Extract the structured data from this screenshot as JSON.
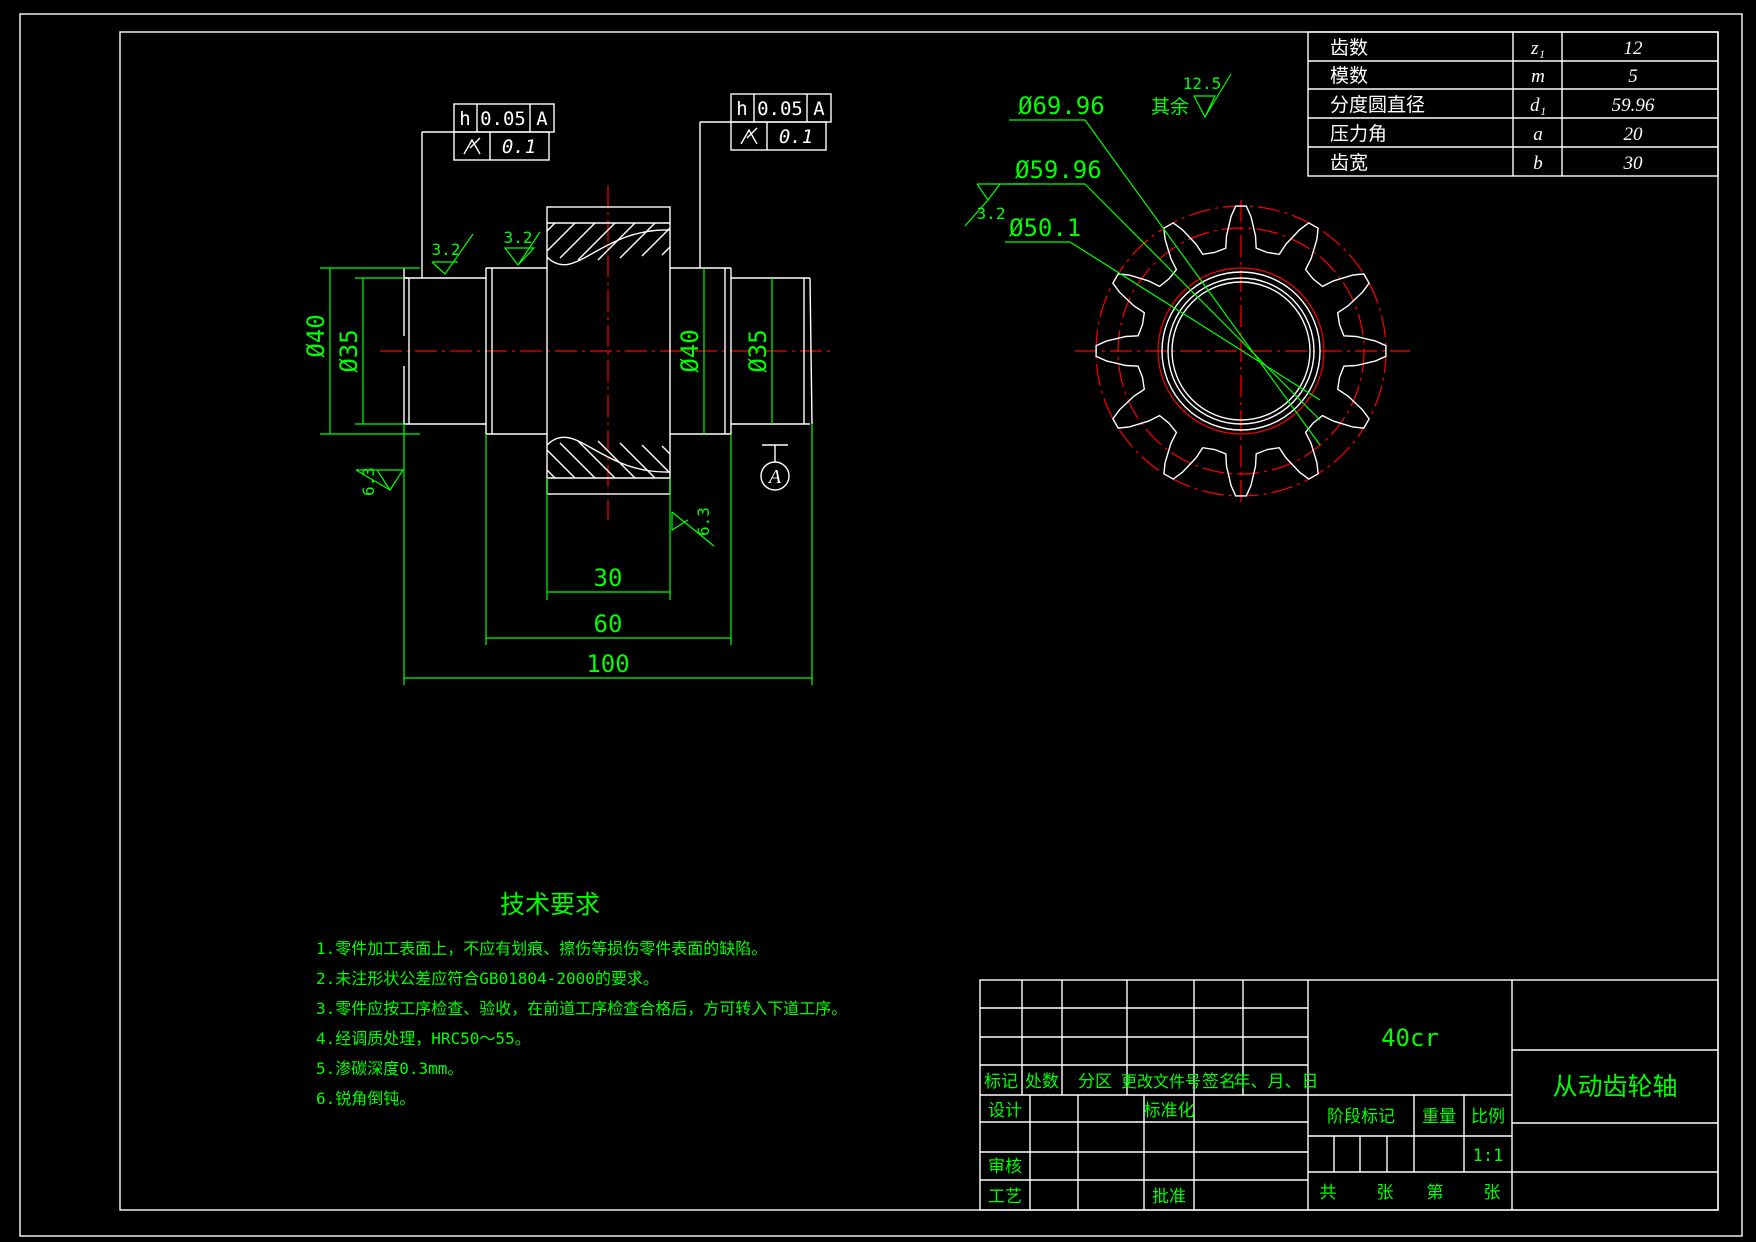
{
  "colors": {
    "background": "#000000",
    "outline": "#ffffff",
    "dimension": "#00ff00",
    "centerline": "#ff0000"
  },
  "dimensions": {
    "left_d40": "Ø40",
    "left_d35": "Ø35",
    "right_d40": "Ø40",
    "right_d35": "Ø35",
    "len_30": "30",
    "len_60": "60",
    "len_100": "100",
    "tip_circle": "Ø69.96",
    "pitch_circle": "Ø59.96",
    "root_circle": "Ø50.1"
  },
  "tolerance_frames": [
    {
      "symbol": "h",
      "value": "0.05",
      "datum": "A",
      "runout_value": "0.1"
    },
    {
      "symbol": "h",
      "value": "0.05",
      "datum": "A",
      "runout_value": "0.1"
    }
  ],
  "roughness": {
    "r1": "3.2",
    "r2": "3.2",
    "r3": "6.3",
    "r4": "6.3",
    "r5": "3.2",
    "rest_value": "12.5",
    "rest_label": "其余"
  },
  "datum_label": "A",
  "gear_params": [
    {
      "name": "齿数",
      "symbol": "z₁",
      "value": "12"
    },
    {
      "name": "模数",
      "symbol": "m",
      "value": "5"
    },
    {
      "name": "分度圆直径",
      "symbol": "d₁",
      "value": "59.96"
    },
    {
      "name": "压力角",
      "symbol": "a",
      "value": "20"
    },
    {
      "name": "齿宽",
      "symbol": "b",
      "value": "30"
    }
  ],
  "tech_requirements": {
    "title": "技术要求",
    "items": [
      "1.零件加工表面上，不应有划痕、擦伤等损伤零件表面的缺陷。",
      "2.未注形状公差应符合GB01804-2000的要求。",
      "3.零件应按工序检查、验收，在前道工序检查合格后，方可转入下道工序。",
      "4.经调质处理，HRC50～55。",
      "5.渗碳深度0.3mm。",
      "6.锐角倒钝。"
    ]
  },
  "title_block": {
    "material": "40cr",
    "part_name": "从动齿轮轴",
    "rev_headers": [
      "标记",
      "处数",
      "分区",
      "更改文件号",
      "签名",
      "年、月、日"
    ],
    "design": "设计",
    "standardize": "标准化",
    "review": "审核",
    "process": "工艺",
    "approve": "批准",
    "stage_mark": "阶段标记",
    "weight": "重量",
    "scale_label": "比例",
    "scale": "1:1",
    "total": "共",
    "sheets": "张",
    "sheet_no": "第",
    "sheet_end": "张"
  }
}
